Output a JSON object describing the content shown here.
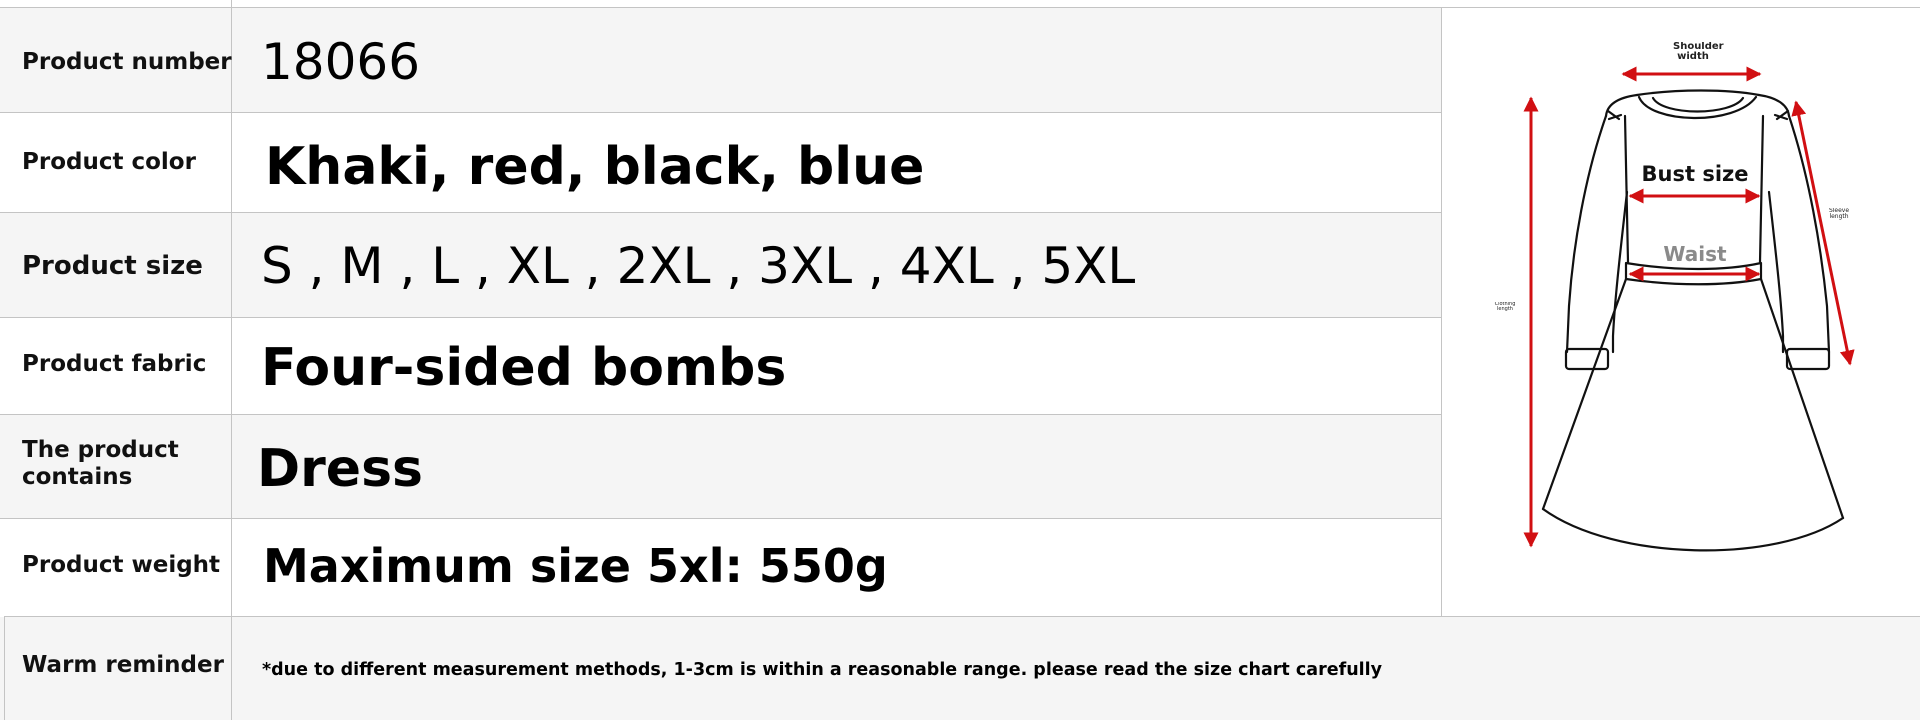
{
  "rows": [
    {
      "label": "Product number",
      "value": "18066"
    },
    {
      "label": "Product color",
      "value": "Khaki, red, black, blue"
    },
    {
      "label": "Product size",
      "value": "S , M , L , XL , 2XL , 3XL , 4XL , 5XL"
    },
    {
      "label": "Product fabric",
      "value": "Four-sided bombs"
    },
    {
      "label": "The product contains",
      "value": "Dress"
    },
    {
      "label": "Product weight",
      "value": "Maximum size 5xl: 550g"
    }
  ],
  "reminder": {
    "label": "Warm reminder",
    "text": "*due to different measurement methods, 1-3cm is within a reasonable range. please read the size chart carefully"
  },
  "size_chart": {
    "shoulder_width": "Shoulder width",
    "bust_size": "Bust size",
    "waist": "Waist",
    "sleeve_length": "Sleeve length",
    "clothing_length": "Clothing length"
  },
  "colors": {
    "row_shade": "#f5f5f5",
    "grid": "#c4c4c4",
    "arrow_red": "#d10f12",
    "waist_gray": "#8a8a8a"
  }
}
